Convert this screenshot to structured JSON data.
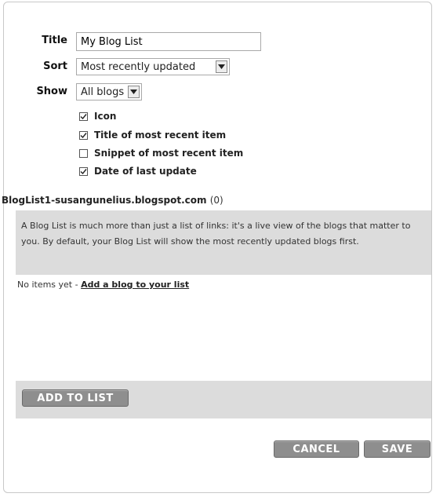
{
  "form": {
    "title_label": "Title",
    "title_value": "My Blog List",
    "sort_label": "Sort",
    "sort_value": "Most recently updated",
    "show_label": "Show",
    "show_value": "All blogs"
  },
  "options": [
    {
      "label": "Icon",
      "checked": true
    },
    {
      "label": "Title of most recent item",
      "checked": true
    },
    {
      "label": "Snippet of most recent item",
      "checked": false
    },
    {
      "label": "Date of last update",
      "checked": true
    }
  ],
  "section": {
    "heading": "BlogList1-susangunelius.blogspot.com",
    "count": "(0)"
  },
  "panel": {
    "description": "A Blog List is much more than just a list of links: it's a live view of the blogs that matter to you. By default, your Blog List will show the most recently updated blogs first.",
    "empty_text": "No items yet - ",
    "add_link": "Add a blog to your list",
    "add_button": "ADD TO LIST"
  },
  "footer": {
    "cancel": "CANCEL",
    "save": "SAVE"
  },
  "colors": {
    "button": "#8e8e8e",
    "panel": "#dcdcdc"
  }
}
